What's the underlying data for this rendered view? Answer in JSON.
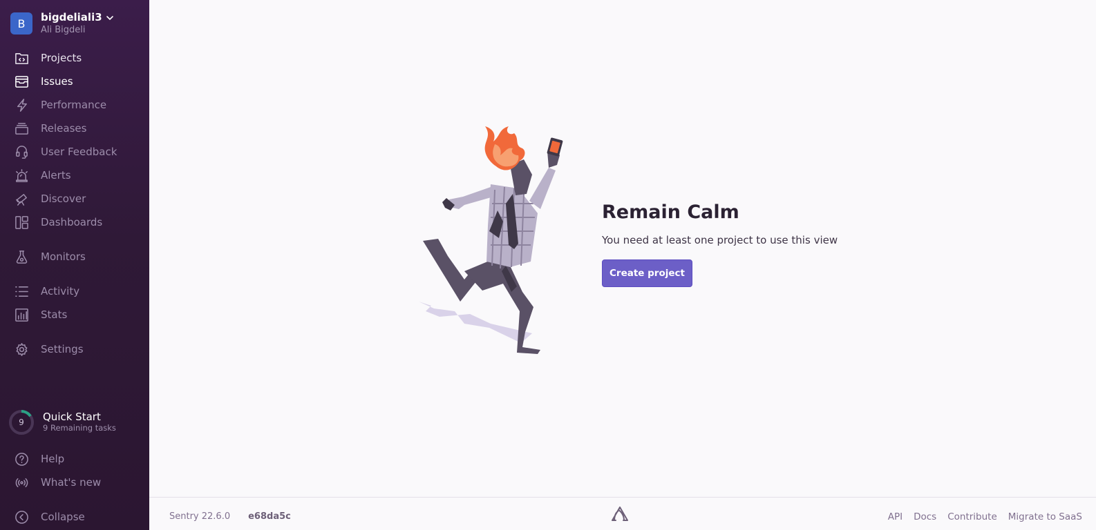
{
  "org": {
    "avatar_letter": "B",
    "name": "bigdeliali3",
    "user": "Ali Bigdeli"
  },
  "nav": {
    "projects": "Projects",
    "issues": "Issues",
    "performance": "Performance",
    "releases": "Releases",
    "user_feedback": "User Feedback",
    "alerts": "Alerts",
    "discover": "Discover",
    "dashboards": "Dashboards",
    "monitors": "Monitors",
    "activity": "Activity",
    "stats": "Stats",
    "settings": "Settings",
    "help": "Help",
    "whats_new": "What's new",
    "collapse": "Collapse"
  },
  "quick_start": {
    "count": "9",
    "title": "Quick Start",
    "subtitle": "9 Remaining tasks"
  },
  "empty_state": {
    "title": "Remain Calm",
    "description": "You need at least one project to use this view",
    "button": "Create project"
  },
  "footer": {
    "version": "Sentry 22.6.0",
    "commit": "e68da5c",
    "links": {
      "api": "API",
      "docs": "Docs",
      "contribute": "Contribute",
      "migrate": "Migrate to SaaS"
    }
  },
  "colors": {
    "sidebar": "#2f1937",
    "accent": "#6c5fc7",
    "avatar": "#3b66c9",
    "progress": "#2ba185"
  }
}
